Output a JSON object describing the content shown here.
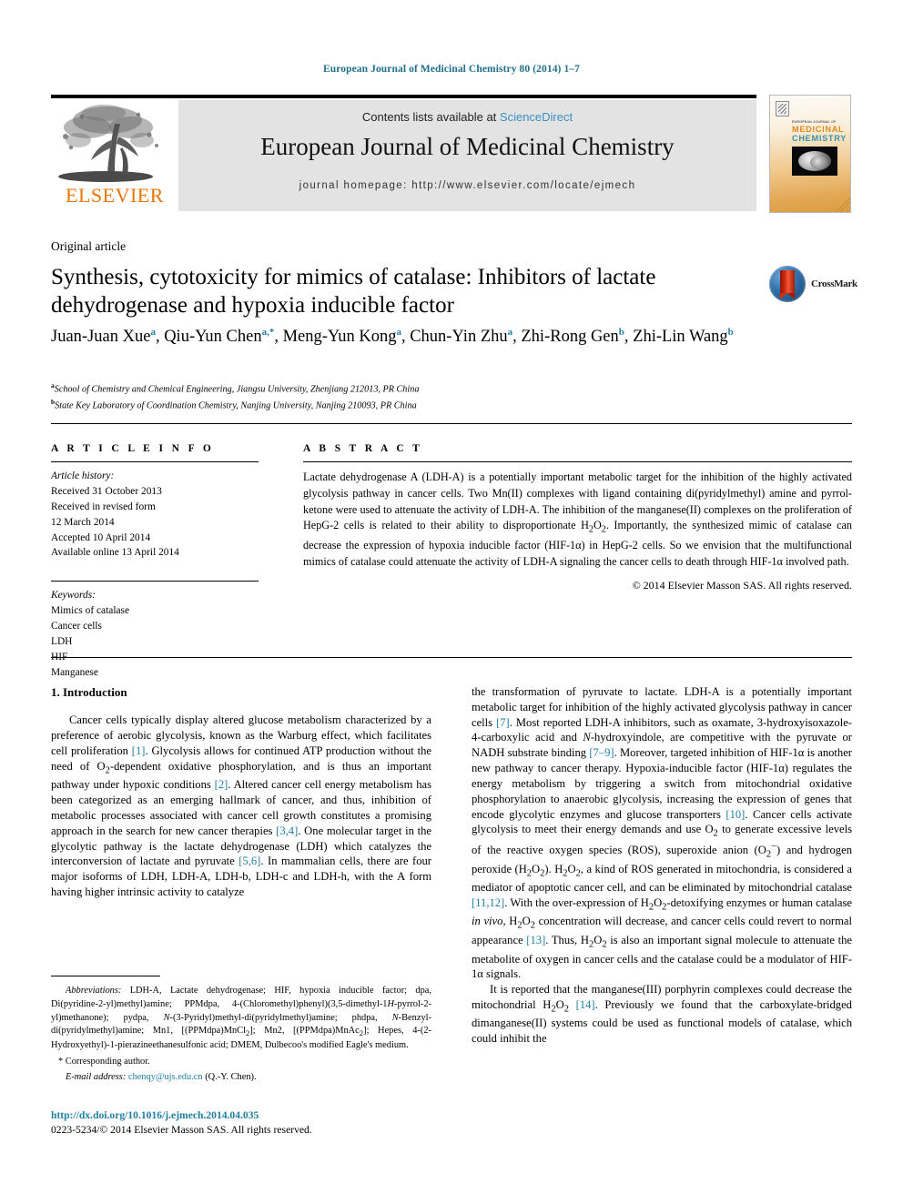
{
  "running_head": "European Journal of Medicinal Chemistry 80 (2014) 1–7",
  "masthead": {
    "contents_prefix": "Contents lists available at ",
    "sciencedirect": "ScienceDirect",
    "journal_title": "European Journal of Medicinal Chemistry",
    "homepage": "journal homepage: http://www.elsevier.com/locate/ejmech",
    "publisher_wordmark": "ELSEVIER"
  },
  "cover": {
    "eyebrow": "EUROPEAN JOURNAL OF",
    "line1": "MEDICINAL",
    "line2": "CHEMISTRY",
    "color_medicinal": "#e08a1e",
    "color_chemistry": "#3e8fa8"
  },
  "crossmark": {
    "label": "CrossMark"
  },
  "article": {
    "kicker": "Original article",
    "title": "Synthesis, cytotoxicity for mimics of catalase: Inhibitors of lactate dehydrogenase and hypoxia inducible factor",
    "authors_html": "Juan-Juan Xue<sup>a</sup>, Qiu-Yun Chen<sup>a,*</sup>, Meng-Yun Kong<sup>a</sup>, Chun-Yin Zhu<sup>a</sup>, Zhi-Rong Gen<sup>b</sup>, Zhi-Lin Wang<sup>b</sup>",
    "affiliations": [
      {
        "marker": "a",
        "text": "School of Chemistry and Chemical Engineering, Jiangsu University, Zhenjiang 212013, PR China"
      },
      {
        "marker": "b",
        "text": "State Key Laboratory of Coordination Chemistry, Nanjing University, Nanjing 210093, PR China"
      }
    ]
  },
  "info": {
    "heading": "A R T I C L E   I N F O",
    "history_label": "Article history:",
    "history": [
      "Received 31 October 2013",
      "Received in revised form",
      "12 March 2014",
      "Accepted 10 April 2014",
      "Available online 13 April 2014"
    ],
    "keywords_label": "Keywords:",
    "keywords": [
      "Mimics of catalase",
      "Cancer cells",
      "LDH",
      "HIF",
      "Manganese"
    ]
  },
  "abstract": {
    "heading": "A B S T R A C T",
    "text": "Lactate dehydrogenase A (LDH-A) is a potentially important metabolic target for the inhibition of the highly activated glycolysis pathway in cancer cells. Two Mn(II) complexes with ligand containing di(pyridylmethyl) amine and pyrrol-ketone were used to attenuate the activity of LDH-A. The inhibition of the manganese(II) complexes on the proliferation of HepG-2 cells is related to their ability to disproportionate H2O2. Importantly, the synthesized mimic of catalase can decrease the expression of hypoxia inducible factor (HIF-1α) in HepG-2 cells. So we envision that the multifunctional mimics of catalase could attenuate the activity of LDH-A signaling the cancer cells to death through HIF-1α involved path.",
    "copyright": "© 2014 Elsevier Masson SAS. All rights reserved."
  },
  "body": {
    "section_heading": "1.  Introduction",
    "left_paragraph_1": "Cancer cells typically display altered glucose metabolism characterized by a preference of aerobic glycolysis, known as the Warburg effect, which facilitates cell proliferation [1]. Glycolysis allows for continued ATP production without the need of O2-dependent oxidative phosphorylation, and is thus an important pathway under hypoxic conditions [2]. Altered cancer cell energy metabolism has been categorized as an emerging hallmark of cancer, and thus, inhibition of metabolic processes associated with cancer cell growth constitutes a promising approach in the search for new cancer therapies [3,4]. One molecular target in the glycolytic pathway is the lactate dehydrogenase (LDH) which catalyzes the interconversion of lactate and pyruvate [5,6]. In mammalian cells, there are four major isoforms of LDH, LDH-A, LDH-b, LDH-c and LDH-h, with the A form having higher intrinsic activity to catalyze",
    "right_paragraph_1": "the transformation of pyruvate to lactate. LDH-A is a potentially important metabolic target for inhibition of the highly activated glycolysis pathway in cancer cells [7]. Most reported LDH-A inhibitors, such as oxamate, 3-hydroxyisoxazole-4-carboxylic acid and N-hydroxyindole, are competitive with the pyruvate or NADH substrate binding [7–9]. Moreover, targeted inhibition of HIF-1α is another new pathway to cancer therapy. Hypoxia-inducible factor (HIF-1α) regulates the energy metabolism by triggering a switch from mitochondrial oxidative phosphorylation to anaerobic glycolysis, increasing the expression of genes that encode glycolytic enzymes and glucose transporters [10]. Cancer cells activate glycolysis to meet their energy demands and use O2 to generate excessive levels of the reactive oxygen species (ROS), superoxide anion (O2−) and hydrogen peroxide (H2O2). H2O2, a kind of ROS generated in mitochondria, is considered a mediator of apoptotic cancer cell, and can be eliminated by mitochondrial catalase [11,12]. With the over-expression of H2O2-detoxifying enzymes or human catalase in vivo, H2O2 concentration will decrease, and cancer cells could revert to normal appearance [13]. Thus, H2O2 is also an important signal molecule to attenuate the metabolite of oxygen in cancer cells and the catalase could be a modulator of HIF-1α signals.",
    "right_paragraph_2": "It is reported that the manganese(III) porphyrin complexes could decrease the mitochondrial H2O2 [14]. Previously we found that the carboxylate-bridged dimanganese(II) systems could be used as functional models of catalase, which could inhibit the"
  },
  "footnote": {
    "abbrev_label": "Abbreviations:",
    "abbrev_text": "LDH-A, Lactate dehydrogenase; HIF, hypoxia inducible factor; dpa, Di(pyridine-2-yl)methyl)amine; PPMdpa, 4-(Chloromethyl)phenyl)(3,5-dimethyl-1H-pyrrol-2-yl)methanone); pydpa, N-(3-Pyridyl)methyl-di(pyridylmethyl)amine; phdpa, N-Benzyl-di(pyridylmethyl)amine; Mn1, [(PPMdpa)MnCl2]; Mn2, [(PPMdpa)MnAc2]; Hepes, 4-(2-Hydroxyethyl)-1-pierazineethanesulfonic acid; DMEM, Dulbecoo's modified Eagle's medium.",
    "corresponding": "* Corresponding author.",
    "email_label": "E-mail address:",
    "email": "chenqy@ujs.edu.cn",
    "email_suffix": "(Q.-Y. Chen)."
  },
  "footer": {
    "doi": "http://dx.doi.org/10.1016/j.ejmech.2014.04.035",
    "issn_line": "0223-5234/© 2014 Elsevier Masson SAS. All rights reserved."
  }
}
